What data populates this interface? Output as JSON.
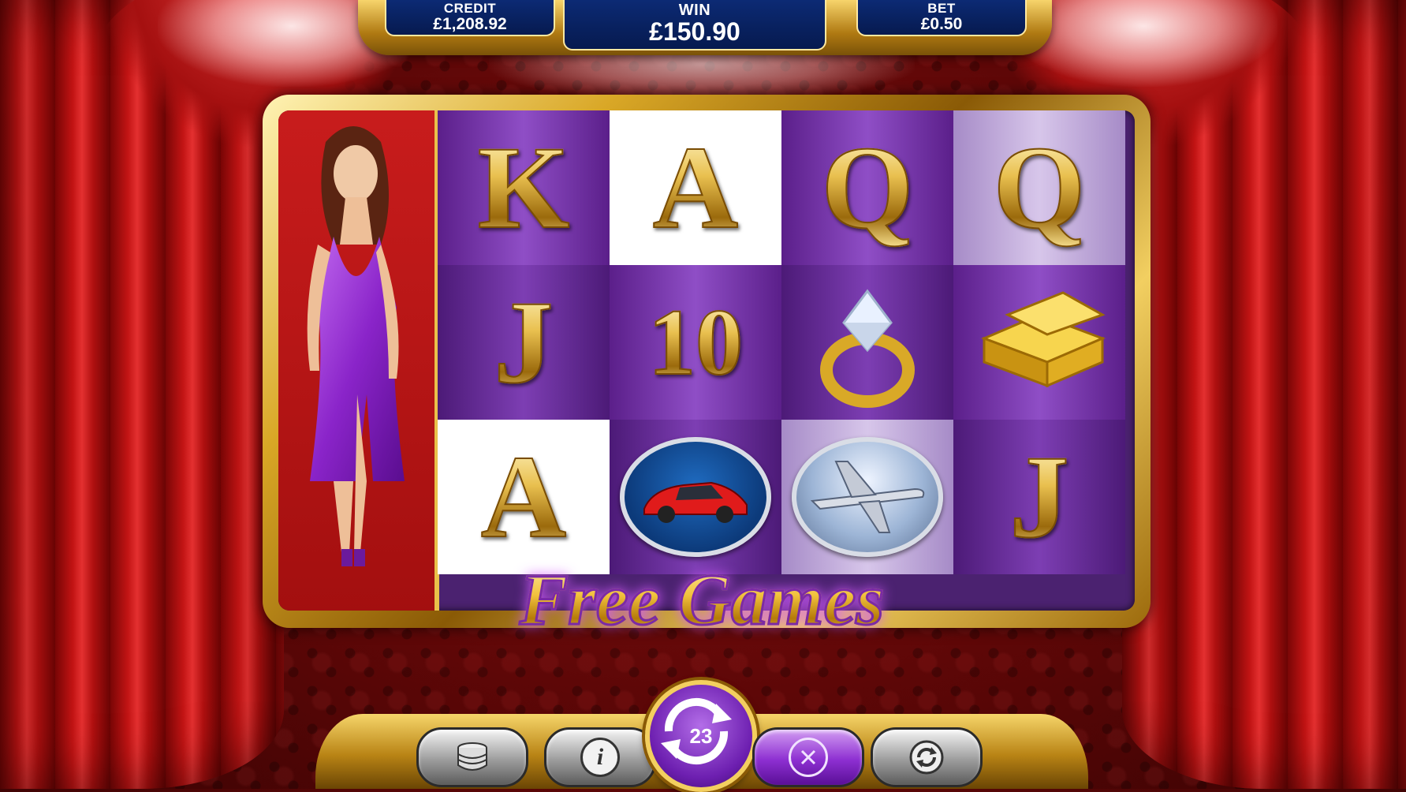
{
  "meters": {
    "credit_label": "CREDIT",
    "credit_value": "£1,208.92",
    "win_label": "WIN",
    "win_value": "£150.90",
    "bet_label": "BET",
    "bet_value": "£0.50"
  },
  "reels": [
    [
      "K",
      "J",
      "A"
    ],
    [
      "A",
      "10",
      "car"
    ],
    [
      "Q",
      "ring",
      "jet"
    ],
    [
      "Q",
      "gold-bars",
      "J"
    ]
  ],
  "banner": "Free Games",
  "controls": {
    "free_spins_remaining": "23",
    "info_symbol": "i"
  },
  "colors": {
    "accent_gold": "#e9c04f",
    "reel_purple": "#5b1f8a",
    "meter_blue": "#0c2a74",
    "background_red": "#8e1414"
  }
}
